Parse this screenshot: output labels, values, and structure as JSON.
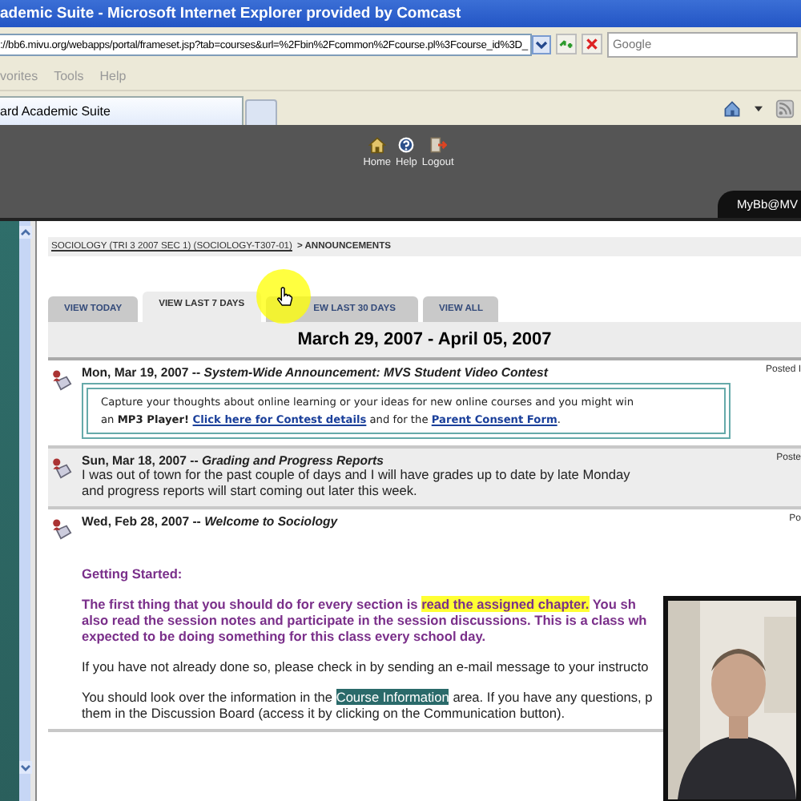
{
  "window": {
    "title": "ademic Suite - Microsoft Internet Explorer provided by Comcast"
  },
  "address_bar": {
    "url": "://bb6.mivu.org/webapps/portal/frameset.jsp?tab=courses&url=%2Fbin%2Fcommon%2Fcourse.pl%3Fcourse_id%3D_",
    "search_placeholder": "Google"
  },
  "menu": [
    "vorites",
    "Tools",
    "Help"
  ],
  "browser_tab": {
    "title": "ard Academic Suite"
  },
  "header_links": [
    {
      "label": "Home",
      "kind": "home"
    },
    {
      "label": "Help",
      "kind": "help"
    },
    {
      "label": "Logout",
      "kind": "logout"
    }
  ],
  "header_tab": "MyBb@MV",
  "breadcrumb": {
    "link": "SOCIOLOGY (TRI 3 2007 SEC 1) (SOCIOLOGY-T307-01)",
    "current": "> ANNOUNCEMENTS"
  },
  "view_tabs": [
    {
      "label": "VIEW TODAY",
      "selected": false
    },
    {
      "label": "VIEW LAST 7 DAYS",
      "selected": true
    },
    {
      "label": "EW LAST 30 DAYS",
      "selected": false
    },
    {
      "label": "VIEW ALL",
      "selected": false
    }
  ],
  "date_range": "March 29, 2007 - April 05, 2007",
  "announcements": [
    {
      "heading": "Mon, Mar 19, 2007 -- *System-Wide Announcement: MVS Student Video Contest*",
      "posted": "Posted I",
      "shaded": false,
      "paragraphs": [
        {
          "kind": "box",
          "lines": [
            [
              {
                "text": "Capture your thoughts about online learning or your ideas for new online courses and you might win",
                "kind": "plain"
              }
            ],
            [
              {
                "text": "an ",
                "kind": "plain"
              },
              {
                "text": "MP3 Player! ",
                "kind": "bold"
              },
              {
                "text": "Click here for Contest details",
                "kind": "link"
              },
              {
                "text": " and for the ",
                "kind": "plain"
              },
              {
                "text": "Parent Consent Form",
                "kind": "link"
              },
              {
                "text": ".",
                "kind": "plain"
              }
            ]
          ]
        }
      ]
    },
    {
      "heading": "Sun, Mar 18, 2007 -- *Grading and Progress Reports*",
      "posted": "Poste",
      "shaded": true,
      "paragraphs": [
        {
          "kind": "plain",
          "lines": [
            [
              {
                "text": "I was out of town for the past couple of days and I will have grades up to date by late Monday",
                "kind": "plain"
              }
            ],
            [
              {
                "text": "and progress reports will start coming out later this week.",
                "kind": "plain"
              }
            ]
          ]
        }
      ]
    },
    {
      "heading": "Wed, Feb 28, 2007 -- *Welcome to Sociology*",
      "posted": "Po",
      "shaded": false,
      "paragraphs": [
        {
          "kind": "heading",
          "lines": [
            [
              {
                "text": "Getting Started:",
                "kind": "plain"
              }
            ]
          ]
        },
        {
          "kind": "emphasis",
          "lines": [
            [
              {
                "text": "The first thing that you should do for every section is ",
                "kind": "plain"
              },
              {
                "text": "read the assigned chapter.",
                "kind": "highlight"
              },
              {
                "text": "  You sh",
                "kind": "plain"
              }
            ],
            [
              {
                "text": "also read the session notes and participate in the session discussions. This is a class wh",
                "kind": "plain"
              }
            ],
            [
              {
                "text": "expected to be doing something for this class every school day.",
                "kind": "plain"
              }
            ]
          ]
        },
        {
          "kind": "plain",
          "lines": [
            [
              {
                "text": "If you have not already done so, please check in by sending an e-mail message to your instructo",
                "kind": "plain"
              }
            ]
          ]
        },
        {
          "kind": "plain",
          "lines": [
            [
              {
                "text": "You should look over the information in the ",
                "kind": "plain"
              },
              {
                "text": "Course Information",
                "kind": "selection"
              },
              {
                "text": " area. If you have any questions, p",
                "kind": "plain"
              }
            ],
            [
              {
                "text": "them in the Discussion Board (access it by clicking on the Communication button).",
                "kind": "plain"
              }
            ]
          ]
        }
      ]
    }
  ],
  "video_overlay": {
    "kind": "picture"
  }
}
